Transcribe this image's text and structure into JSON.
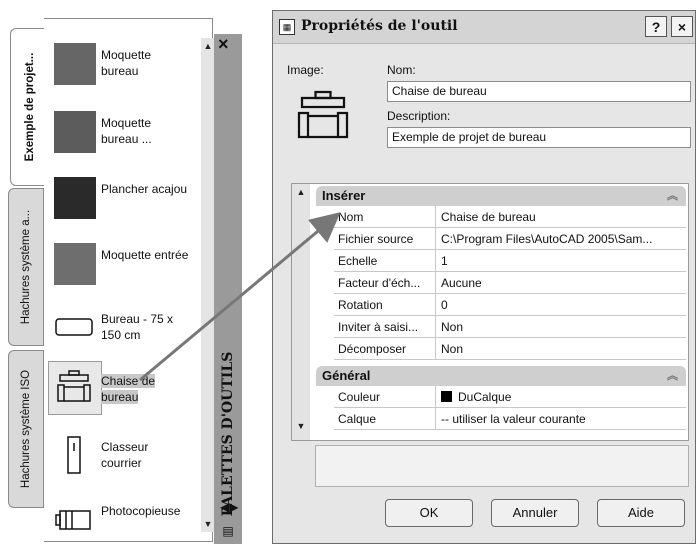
{
  "palette": {
    "tabs": [
      "Exemple de projet...",
      "Hachures système a...",
      "Hachures système ISO"
    ],
    "tools": [
      {
        "label": "Moquette bureau",
        "color": "#666666"
      },
      {
        "label": "Moquette bureau ...",
        "color": "#5c5c5c"
      },
      {
        "label": "Plancher acajou",
        "color": "#2a2a2a"
      },
      {
        "label": "Moquette entrée",
        "color": "#6e6e6e"
      },
      {
        "label": "Bureau - 75 x 150 cm"
      },
      {
        "label": "Chaise de bureau"
      },
      {
        "label": "Classeur courrier"
      },
      {
        "label": "Photocopieuse"
      }
    ],
    "close_label": "×",
    "sidebar_title": "PALETTES D'OUTILS"
  },
  "dialog": {
    "title": "Propriétés de l'outil",
    "help_label": "?",
    "close_label": "×",
    "image_label": "Image:",
    "name_label": "Nom:",
    "name_value": "Chaise de bureau",
    "description_label": "Description:",
    "description_value": "Exemple de projet de bureau",
    "sections": [
      {
        "title": "Insérer",
        "rows": [
          {
            "key": "Nom",
            "value": "Chaise de bureau"
          },
          {
            "key": "Fichier source",
            "value": "C:\\Program Files\\AutoCAD 2005\\Sam..."
          },
          {
            "key": "Echelle",
            "value": "1"
          },
          {
            "key": "Facteur d'éch...",
            "value": "Aucune"
          },
          {
            "key": "Rotation",
            "value": "0"
          },
          {
            "key": "Inviter à saisi...",
            "value": "Non"
          },
          {
            "key": "Décomposer",
            "value": "Non"
          }
        ]
      },
      {
        "title": "Général",
        "rows": [
          {
            "key": "Couleur",
            "value": "DuCalque"
          },
          {
            "key": "Calque",
            "value": "-- utiliser la valeur courante"
          }
        ]
      }
    ],
    "buttons": {
      "ok": "OK",
      "cancel": "Annuler",
      "help": "Aide"
    }
  }
}
